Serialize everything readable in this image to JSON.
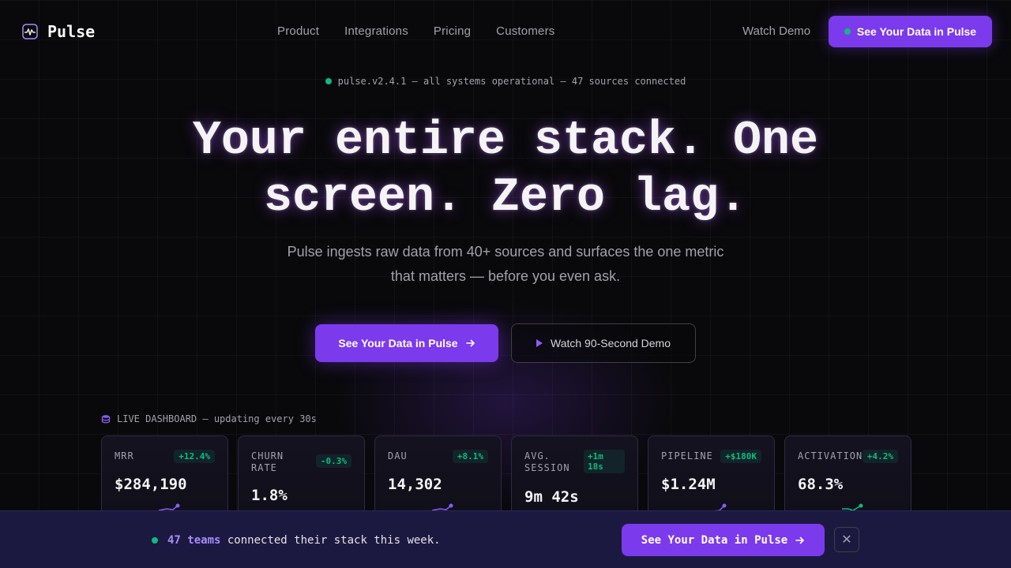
{
  "brand": {
    "name": "Pulse",
    "accent": "#7c3aed",
    "success": "#10b981"
  },
  "nav": {
    "links": [
      "Product",
      "Integrations",
      "Pricing",
      "Customers"
    ],
    "watch_demo": "Watch Demo",
    "cta": "See Your Data in Pulse"
  },
  "status": {
    "text": "pulse.v2.4.1 — all systems operational — 47 sources connected"
  },
  "hero": {
    "headline_line1": "Your entire stack. One",
    "headline_line2": "screen. Zero lag.",
    "sub_line1": "Pulse ingests raw data from 40+ sources and surfaces the one metric",
    "sub_line2": "that matters — before you even ask.",
    "primary_cta": "See Your Data in Pulse",
    "secondary_cta": "Watch 90-Second Demo"
  },
  "dashboard": {
    "label": "LIVE DASHBOARD — updating every 30s",
    "cards": [
      {
        "label": "MRR",
        "delta": "+12.4%",
        "value": "$284,190",
        "spark_color": "#8b5cf6",
        "trend": "up"
      },
      {
        "label": "CHURN RATE",
        "delta": "-0.3%",
        "value": "1.8%",
        "spark_color": "#10b981",
        "trend": "down"
      },
      {
        "label": "DAU",
        "delta": "+8.1%",
        "value": "14,302",
        "spark_color": "#8b5cf6",
        "trend": "up"
      },
      {
        "label": "AVG. SESSION",
        "delta": "+1m 18s",
        "value": "9m 42s",
        "spark_color": "#8b5cf6",
        "trend": "up"
      },
      {
        "label": "PIPELINE",
        "delta": "+$180K",
        "value": "$1.24M",
        "spark_color": "#8b5cf6",
        "trend": "up"
      },
      {
        "label": "ACTIVATION",
        "delta": "+4.2%",
        "value": "68.3%",
        "spark_color": "#10b981",
        "trend": "up"
      }
    ]
  },
  "bottom_bar": {
    "count": "47 teams",
    "message": "connected their stack this week.",
    "cta": "See Your Data in Pulse",
    "close": "✕"
  }
}
